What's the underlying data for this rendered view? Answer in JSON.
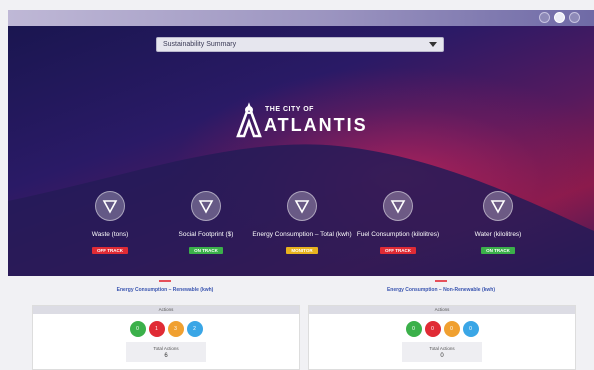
{
  "header": {
    "dropdown_value": "Sustainability Summary"
  },
  "logo": {
    "line1": "THE CITY OF",
    "line2": "ATLANTIS"
  },
  "metrics": [
    {
      "label": "Waste (tons)",
      "status": "OFF TRACK",
      "status_color": "#e02b35"
    },
    {
      "label": "Social Footprint ($)",
      "status": "ON TRACK",
      "status_color": "#3bb04a"
    },
    {
      "label": "Energy Consumption – Total (kwh)",
      "status": "MONITOR",
      "status_color": "#e8b21e"
    },
    {
      "label": "Fuel Consumption (kilolitres)",
      "status": "OFF TRACK",
      "status_color": "#e02b35"
    },
    {
      "label": "Water (kilolitres)",
      "status": "ON TRACK",
      "status_color": "#3bb04a"
    }
  ],
  "panels": [
    {
      "title": "Energy Consumption – Renewable (kwh)",
      "header": "Actions",
      "counts": [
        "0",
        "1",
        "3",
        "2"
      ],
      "total_label": "Total Actions",
      "total_value": "6"
    },
    {
      "title": "Energy Consumption – Non-Renewable (kwh)",
      "header": "Actions",
      "counts": [
        "0",
        "0",
        "0",
        "0"
      ],
      "total_label": "Total Actions",
      "total_value": "0"
    }
  ]
}
